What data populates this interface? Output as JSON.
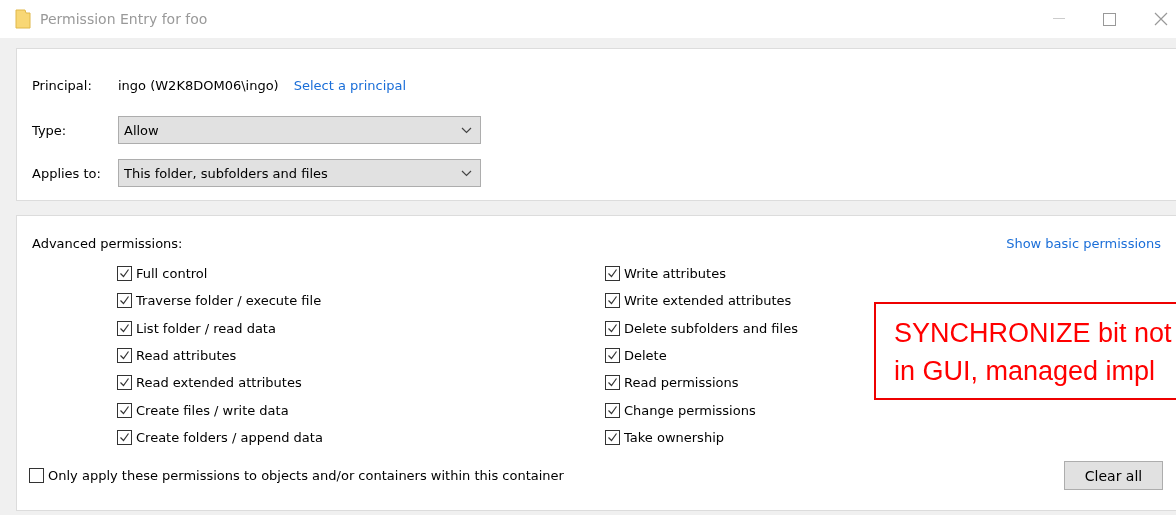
{
  "window": {
    "title": "Permission Entry for foo"
  },
  "principal": {
    "label": "Principal:",
    "value": "ingo (W2K8DOM06\\ingo)",
    "link": "Select a principal"
  },
  "fields": [
    {
      "label": "Type:",
      "value": "Allow"
    },
    {
      "label": "Applies to:",
      "value": "This folder, subfolders and files"
    }
  ],
  "permissions": {
    "title": "Advanced permissions:",
    "link": "Show basic permissions",
    "columns": [
      [
        {
          "label": "Full control",
          "checked": true
        },
        {
          "label": "Traverse folder / execute file",
          "checked": true
        },
        {
          "label": "List folder / read data",
          "checked": true
        },
        {
          "label": "Read attributes",
          "checked": true
        },
        {
          "label": "Read extended attributes",
          "checked": true
        },
        {
          "label": "Create files / write data",
          "checked": true
        },
        {
          "label": "Create folders / append data",
          "checked": true
        }
      ],
      [
        {
          "label": "Write attributes",
          "checked": true
        },
        {
          "label": "Write extended attributes",
          "checked": true
        },
        {
          "label": "Delete subfolders and files",
          "checked": true
        },
        {
          "label": "Delete",
          "checked": true
        },
        {
          "label": "Read permissions",
          "checked": true
        },
        {
          "label": "Change permissions",
          "checked": true
        },
        {
          "label": "Take ownership",
          "checked": true
        }
      ]
    ],
    "only_apply": {
      "label": "Only apply these permissions to objects and/or containers within this container",
      "checked": false
    },
    "button": "Clear all"
  },
  "annotation": {
    "lines": [
      "SYNCHRONIZE bit not",
      "in GUI, managed impl"
    ]
  }
}
